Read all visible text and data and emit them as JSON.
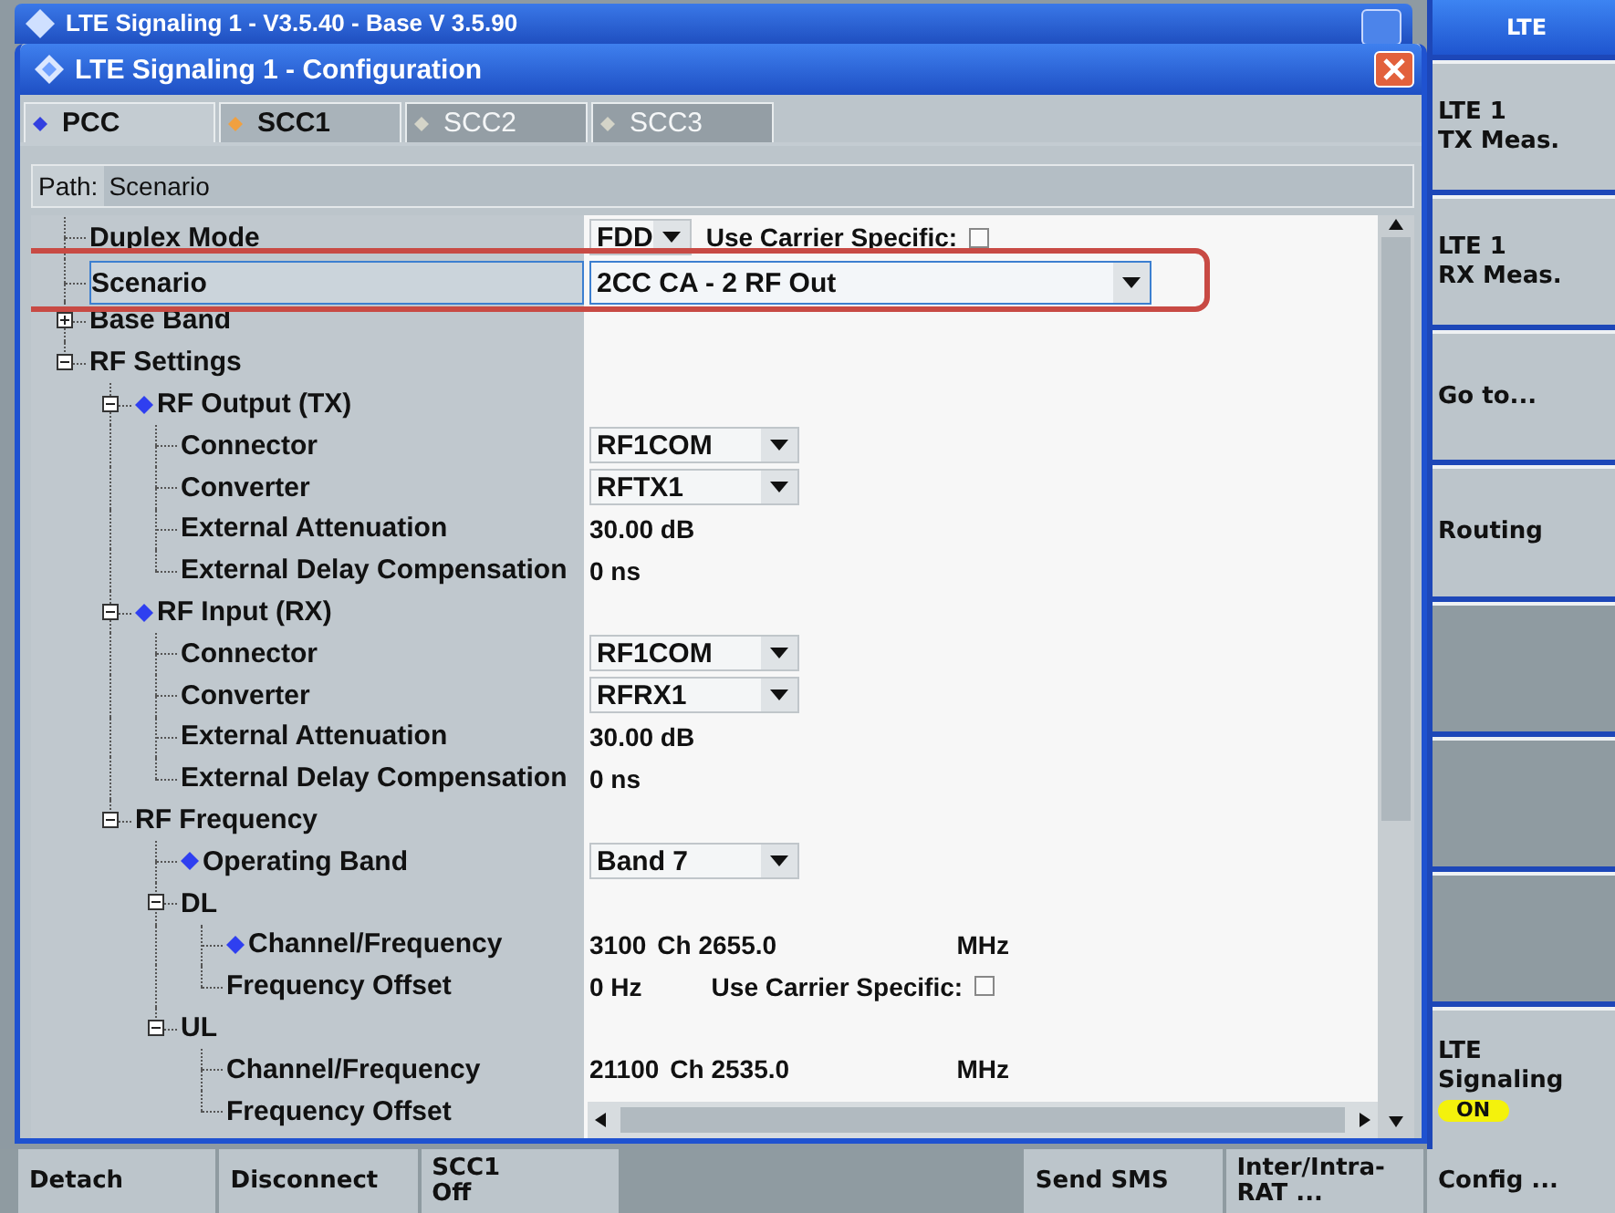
{
  "back_window": {
    "title": "LTE Signaling 1 - V3.5.40 - Base V 3.5.90"
  },
  "dialog": {
    "title": "LTE Signaling 1 - Configuration",
    "tabs": [
      {
        "label": "PCC",
        "selected": true,
        "disabled": false,
        "color": "#3340e0"
      },
      {
        "label": "SCC1",
        "selected": false,
        "disabled": false,
        "color": "#f0a040"
      },
      {
        "label": "SCC2",
        "selected": false,
        "disabled": true,
        "color": "#d4d4c8"
      },
      {
        "label": "SCC3",
        "selected": false,
        "disabled": true,
        "color": "#d4d4c8"
      }
    ],
    "path": {
      "label": "Path:",
      "value": "Scenario"
    },
    "annotation": {
      "kind": "frame"
    },
    "tree": [
      {
        "label": "Duplex Mode",
        "marker": false,
        "selected": false,
        "value": {
          "kind": "dropdown",
          "text": "FDD",
          "option": {
            "label": "Use Carrier Specific:",
            "checked": false
          }
        }
      },
      {
        "label": "Scenario",
        "marker": false,
        "selected": true,
        "value": {
          "kind": "combo",
          "text": "2CC CA - 2 RF Out"
        }
      },
      {
        "label": "Base Band",
        "marker": false,
        "selected": false,
        "expanded": false
      },
      {
        "label": "RF Settings",
        "marker": false,
        "selected": false,
        "expanded": true,
        "children": [
          {
            "label": "RF Output (TX)",
            "marker": true,
            "selected": false,
            "expanded": true,
            "children": [
              {
                "label": "Connector",
                "marker": false,
                "selected": false,
                "value": {
                  "kind": "dropdown",
                  "text": "RF1COM"
                }
              },
              {
                "label": "Converter",
                "marker": false,
                "selected": false,
                "value": {
                  "kind": "dropdown",
                  "text": "RFTX1"
                }
              },
              {
                "label": "External Attenuation",
                "marker": false,
                "selected": false,
                "value": {
                  "kind": "text",
                  "text": "30.00 dB"
                }
              },
              {
                "label": "External Delay Compensation",
                "marker": false,
                "selected": false,
                "value": {
                  "kind": "text",
                  "text": "0 ns"
                }
              }
            ]
          },
          {
            "label": "RF Input (RX)",
            "marker": true,
            "selected": false,
            "expanded": true,
            "children": [
              {
                "label": "Connector",
                "marker": false,
                "selected": false,
                "value": {
                  "kind": "dropdown",
                  "text": "RF1COM"
                }
              },
              {
                "label": "Converter",
                "marker": false,
                "selected": false,
                "value": {
                  "kind": "dropdown",
                  "text": "RFRX1"
                }
              },
              {
                "label": "External Attenuation",
                "marker": false,
                "selected": false,
                "value": {
                  "kind": "text",
                  "text": "30.00 dB"
                }
              },
              {
                "label": "External Delay Compensation",
                "marker": false,
                "selected": false,
                "value": {
                  "kind": "text",
                  "text": "0 ns"
                }
              }
            ]
          },
          {
            "label": "RF Frequency",
            "marker": false,
            "selected": false,
            "expanded": true,
            "children": [
              {
                "label": "Operating Band",
                "marker": true,
                "selected": false,
                "value": {
                  "kind": "dropdown",
                  "text": "Band 7"
                }
              },
              {
                "label": "DL",
                "marker": false,
                "selected": false,
                "expanded": true,
                "children": [
                  {
                    "label": "Channel/Frequency",
                    "marker": true,
                    "selected": false,
                    "value": {
                      "kind": "channel",
                      "channel": "3100",
                      "frequency": "Ch 2655.0",
                      "unit": "MHz"
                    }
                  },
                  {
                    "label": "Frequency Offset",
                    "marker": false,
                    "selected": false,
                    "value": {
                      "kind": "text",
                      "text": "0 Hz",
                      "option": {
                        "label": "Use Carrier Specific:",
                        "checked": false
                      }
                    }
                  }
                ]
              },
              {
                "label": "UL",
                "marker": false,
                "selected": false,
                "expanded": true,
                "children": [
                  {
                    "label": "Channel/Frequency",
                    "marker": false,
                    "selected": false,
                    "value": {
                      "kind": "channel",
                      "channel": "21100",
                      "frequency": "Ch 2535.0",
                      "unit": "MHz"
                    }
                  },
                  {
                    "label": "Frequency Offset",
                    "marker": false,
                    "selected": false
                  }
                ]
              }
            ]
          }
        ]
      }
    ]
  },
  "side_keys": [
    {
      "kind": "header",
      "label": "LTE"
    },
    {
      "kind": "key",
      "label": "LTE 1\nTX Meas."
    },
    {
      "kind": "key",
      "label": "LTE 1\nRX Meas."
    },
    {
      "kind": "key",
      "label": "Go to..."
    },
    {
      "kind": "key",
      "label": "Routing"
    },
    {
      "kind": "empty"
    },
    {
      "kind": "empty"
    },
    {
      "kind": "empty"
    },
    {
      "kind": "key",
      "label": "LTE\nSignaling",
      "badge": "ON"
    }
  ],
  "bottom_keys": [
    {
      "kind": "key",
      "label": "Detach"
    },
    {
      "kind": "key",
      "label": "Disconnect"
    },
    {
      "kind": "key",
      "label": "SCC1\nOff"
    },
    {
      "kind": "empty"
    },
    {
      "kind": "empty"
    },
    {
      "kind": "key",
      "label": "Send SMS"
    },
    {
      "kind": "key",
      "label": "Inter/Intra-\nRAT ..."
    },
    {
      "kind": "key",
      "label": "Config ..."
    }
  ]
}
